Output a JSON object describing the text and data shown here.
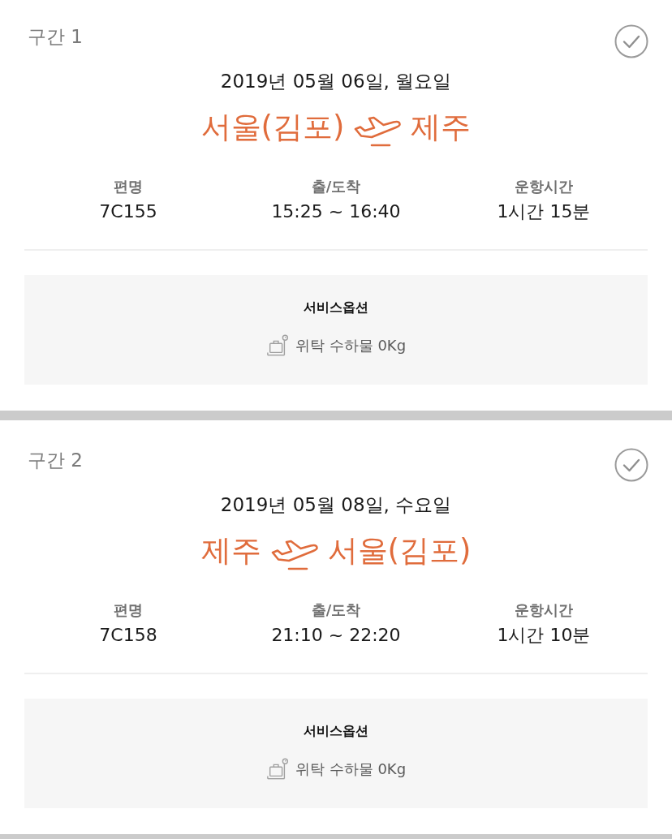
{
  "segments": [
    {
      "label": "구간 1",
      "date": "2019년 05월 06일, 월요일",
      "origin": "서울(김포)",
      "destination": "제주",
      "details": [
        {
          "label": "편명",
          "value": "7C155"
        },
        {
          "label": "출/도착",
          "value": "15:25 ~ 16:40"
        },
        {
          "label": "운항시간",
          "value": "1시간 15분"
        }
      ],
      "service_options": {
        "title": "서비스옵션",
        "items": [
          "위탁 수하물 0Kg"
        ]
      }
    },
    {
      "label": "구간 2",
      "date": "2019년 05월 08일, 수요일",
      "origin": "제주",
      "destination": "서울(김포)",
      "details": [
        {
          "label": "편명",
          "value": "7C158"
        },
        {
          "label": "출/도착",
          "value": "21:10 ~ 22:20"
        },
        {
          "label": "운항시간",
          "value": "1시간 10분"
        }
      ],
      "service_options": {
        "title": "서비스옵션",
        "items": [
          "위탁 수하물 0Kg"
        ]
      }
    }
  ]
}
